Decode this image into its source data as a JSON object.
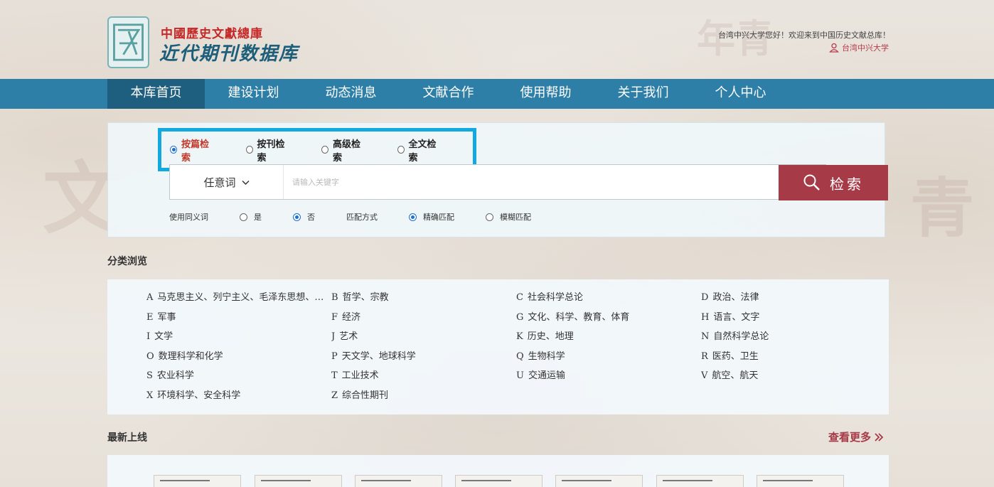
{
  "header": {
    "logo_line1": "中國歷史文獻總庫",
    "logo_line2": "近代期刊数据库",
    "welcome": "台湾中兴大学您好！欢迎来到中国历史文献总库！",
    "user_name": "台湾中兴大学"
  },
  "nav": {
    "items": [
      {
        "label": "本库首页"
      },
      {
        "label": "建设计划"
      },
      {
        "label": "动态消息"
      },
      {
        "label": "文献合作"
      },
      {
        "label": "使用帮助"
      },
      {
        "label": "关于我们"
      },
      {
        "label": "个人中心"
      }
    ],
    "active_index": 0
  },
  "search": {
    "types": [
      {
        "label": "按篇检索",
        "selected": true
      },
      {
        "label": "按刊检索",
        "selected": false
      },
      {
        "label": "高级检索",
        "selected": false
      },
      {
        "label": "全文检索",
        "selected": false
      }
    ],
    "field_select": "任意词",
    "placeholder": "请输入关键字",
    "button_label": "检索",
    "synonym_label": "使用同义词",
    "synonym_yes": "是",
    "synonym_no": "否",
    "synonym_value": "否",
    "match_label": "匹配方式",
    "match_exact": "精确匹配",
    "match_fuzzy": "模糊匹配",
    "match_value": "精确匹配"
  },
  "categories": {
    "title": "分类浏览",
    "items": [
      {
        "code": "A",
        "label": "马克思主义、列宁主义、毛泽东思想、邓小平理论"
      },
      {
        "code": "B",
        "label": "哲学、宗教"
      },
      {
        "code": "C",
        "label": "社会科学总论"
      },
      {
        "code": "D",
        "label": "政治、法律"
      },
      {
        "code": "E",
        "label": "军事"
      },
      {
        "code": "F",
        "label": "经济"
      },
      {
        "code": "G",
        "label": "文化、科学、教育、体育"
      },
      {
        "code": "H",
        "label": "语言、文字"
      },
      {
        "code": "I",
        "label": "文学"
      },
      {
        "code": "J",
        "label": "艺术"
      },
      {
        "code": "K",
        "label": "历史、地理"
      },
      {
        "code": "N",
        "label": "自然科学总论"
      },
      {
        "code": "O",
        "label": "数理科学和化学"
      },
      {
        "code": "P",
        "label": "天文学、地球科学"
      },
      {
        "code": "Q",
        "label": "生物科学"
      },
      {
        "code": "R",
        "label": "医药、卫生"
      },
      {
        "code": "S",
        "label": "农业科学"
      },
      {
        "code": "T",
        "label": "工业技术"
      },
      {
        "code": "U",
        "label": "交通运输"
      },
      {
        "code": "V",
        "label": "航空、航天"
      },
      {
        "code": "X",
        "label": "环境科学、安全科学"
      },
      {
        "code": "Z",
        "label": "综合性期刊"
      }
    ]
  },
  "newest": {
    "title": "最新上线",
    "more_label": "查看更多"
  },
  "colors": {
    "nav_bg": "#2d7fa7",
    "nav_active": "#1e5e7f",
    "accent_red": "#a73a47",
    "highlight_border": "#12a8e0"
  },
  "icons": {
    "logo": "book-logo-icon",
    "user": "user-icon",
    "dropdown": "chevron-down-icon",
    "search": "magnifier-icon",
    "more": "double-chevron-right-icon"
  }
}
